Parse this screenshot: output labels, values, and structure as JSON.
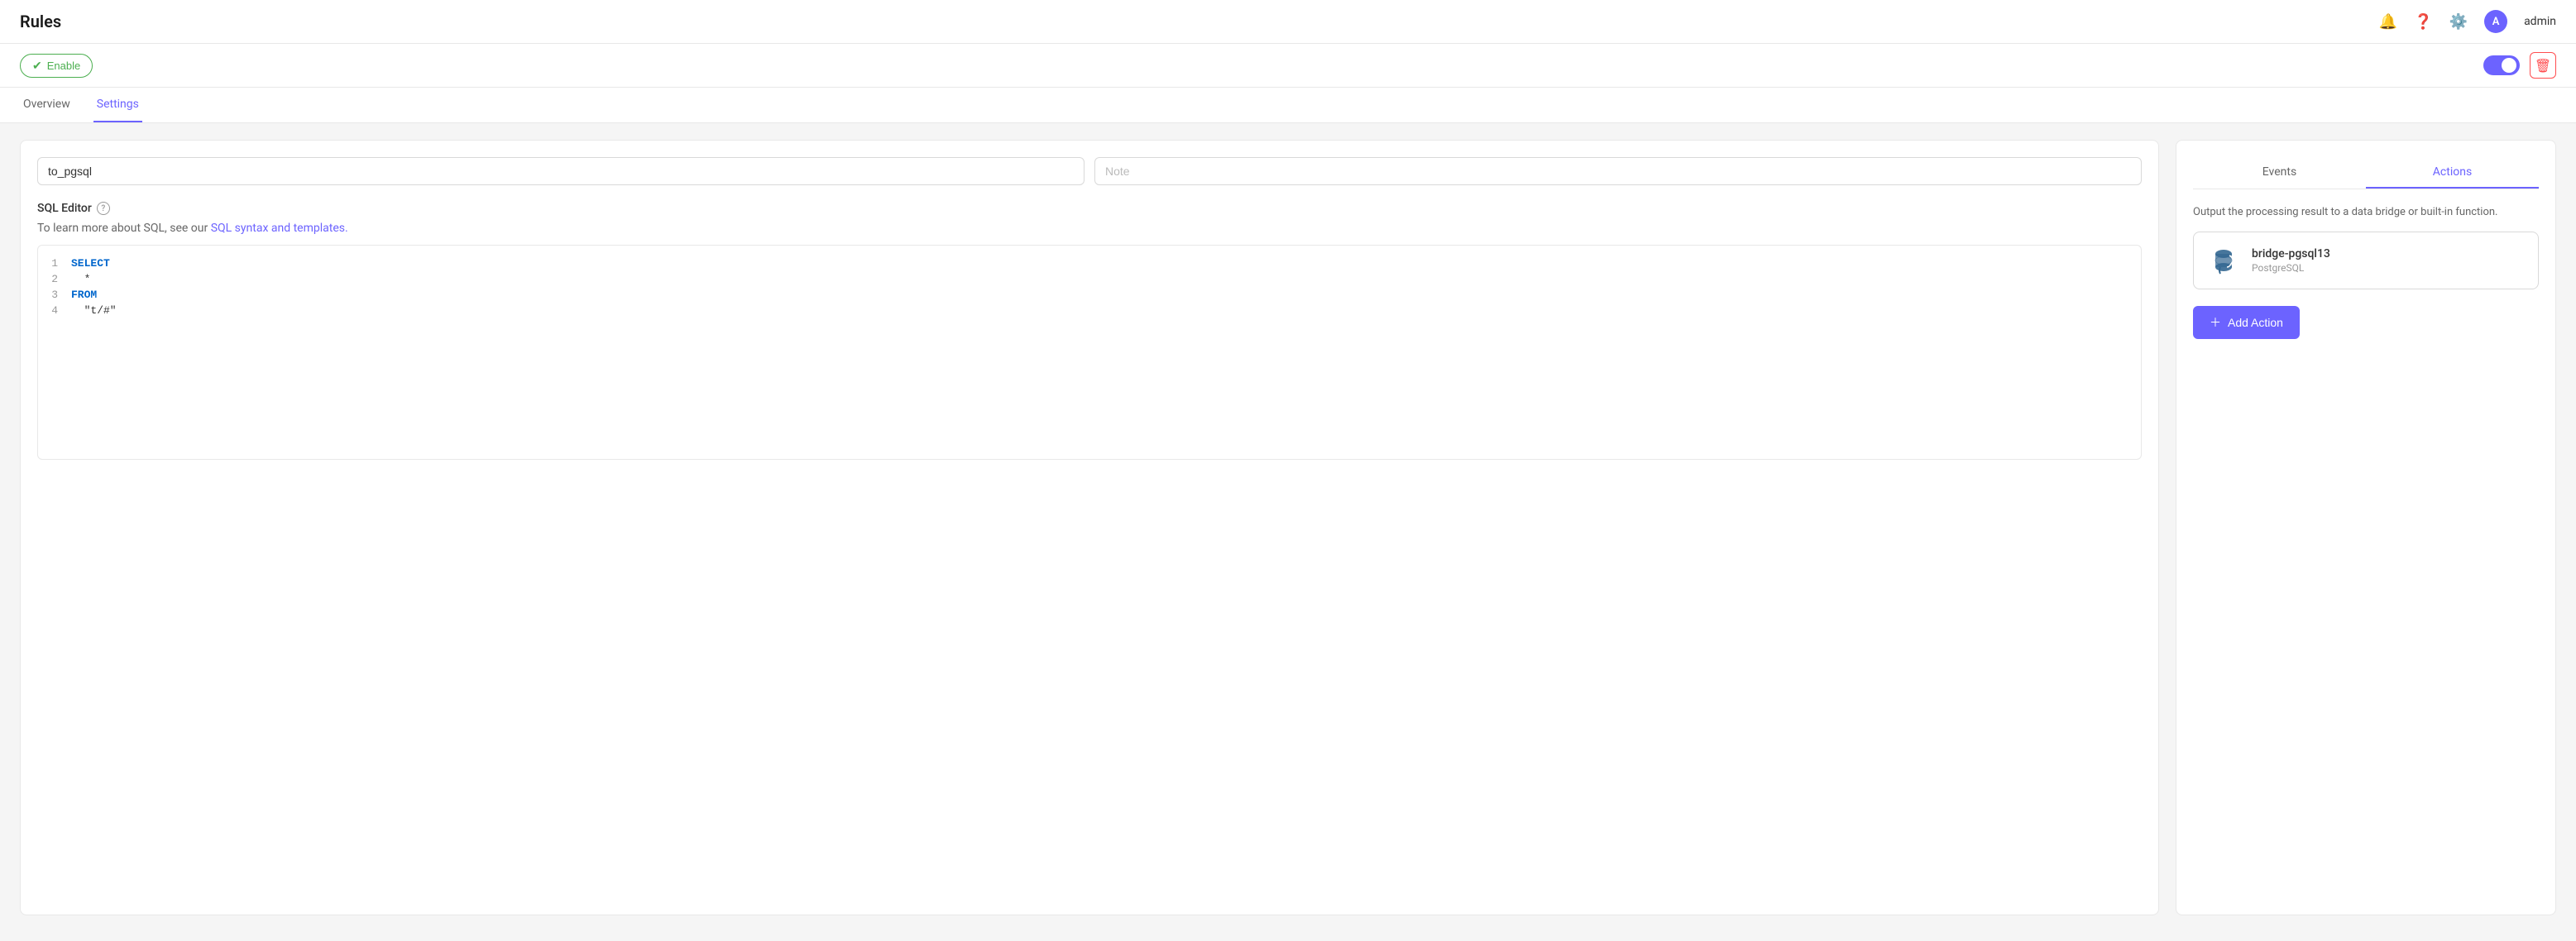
{
  "header": {
    "title": "Rules",
    "admin_label": "admin",
    "avatar_letter": "A"
  },
  "toolbar": {
    "enable_label": "Enable",
    "toggle_on": true
  },
  "tabs": [
    {
      "id": "overview",
      "label": "Overview",
      "active": false
    },
    {
      "id": "settings",
      "label": "Settings",
      "active": true
    }
  ],
  "left_panel": {
    "rule_name": "to_pgsql",
    "note_placeholder": "Note",
    "sql_editor_label": "SQL Editor",
    "sql_learn_text": "To learn more about SQL, see our",
    "sql_link_text": "SQL syntax and templates.",
    "code_lines": [
      {
        "number": "1",
        "content_html": "<span class='kw'>SELECT</span>"
      },
      {
        "number": "2",
        "content_html": "<span class='indent'></span>*"
      },
      {
        "number": "3",
        "content_html": "<span class='kw'>FROM</span>"
      },
      {
        "number": "4",
        "content_html": "<span class='indent'></span>\"t/#\""
      }
    ]
  },
  "right_panel": {
    "tabs": [
      {
        "id": "events",
        "label": "Events",
        "active": false
      },
      {
        "id": "actions",
        "label": "Actions",
        "active": true
      }
    ],
    "description": "Output the processing result to a data bridge or built-in function.",
    "bridge": {
      "name": "bridge-pgsql13",
      "type": "PostgreSQL"
    },
    "add_action_label": "+ Add Action"
  }
}
